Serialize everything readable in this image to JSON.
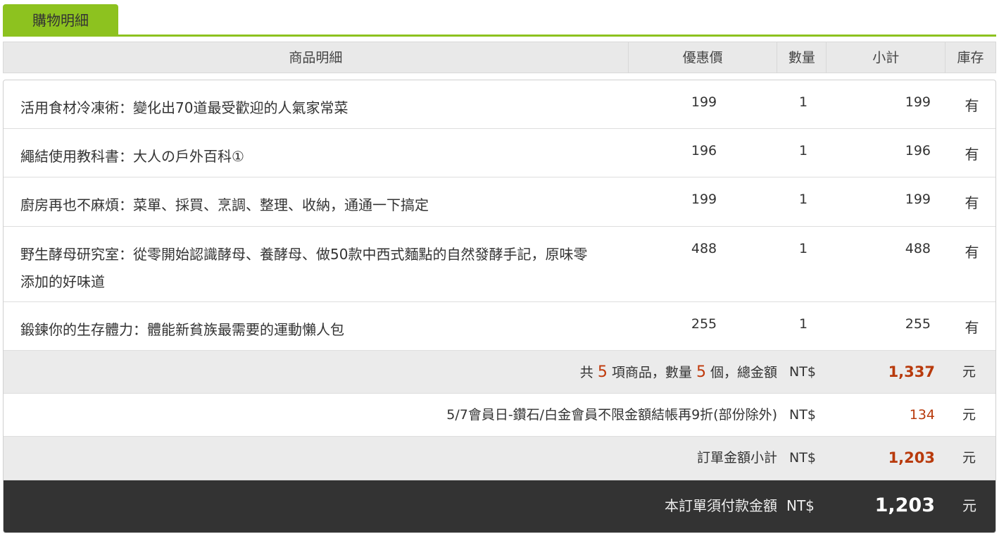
{
  "tab": {
    "label": "購物明細"
  },
  "header": {
    "name": "商品明細",
    "price": "優惠價",
    "qty": "數量",
    "subtotal": "小計",
    "stock": "庫存"
  },
  "items": [
    {
      "name": "活用食材冷凍術：變化出70道最受歡迎的人氣家常菜",
      "price": "199",
      "qty": "1",
      "subtotal": "199",
      "stock": "有"
    },
    {
      "name": "繩結使用教科書：大人の戶外百科①",
      "price": "196",
      "qty": "1",
      "subtotal": "196",
      "stock": "有"
    },
    {
      "name": "廚房再也不麻煩：菜單、採買、烹調、整理、收納，通通一下搞定",
      "price": "199",
      "qty": "1",
      "subtotal": "199",
      "stock": "有"
    },
    {
      "name": "野生酵母研究室：從零開始認識酵母、養酵母、做50款中西式麵點的自然發酵手記，原味零添加的好味道",
      "price": "488",
      "qty": "1",
      "subtotal": "488",
      "stock": "有"
    },
    {
      "name": "鍛鍊你的生存體力：體能新貧族最需要的運動懶人包",
      "price": "255",
      "qty": "1",
      "subtotal": "255",
      "stock": "有"
    }
  ],
  "summary": {
    "count_prefix": "共",
    "item_count": "5",
    "count_mid": "項商品，數量",
    "qty_count": "5",
    "count_suffix": "個，總金額",
    "currency": "NT$",
    "total": "1,337",
    "unit": "元"
  },
  "discount": {
    "label": "5/7會員日-鑽石/白金會員不限金額結帳再9折(部份除外)",
    "currency": "NT$",
    "amount": "134",
    "unit": "元"
  },
  "order_subtotal": {
    "label": "訂單金額小計",
    "currency": "NT$",
    "amount": "1,203",
    "unit": "元"
  },
  "payable": {
    "label": "本訂單須付款金額",
    "currency": "NT$",
    "amount": "1,203",
    "unit": "元"
  }
}
